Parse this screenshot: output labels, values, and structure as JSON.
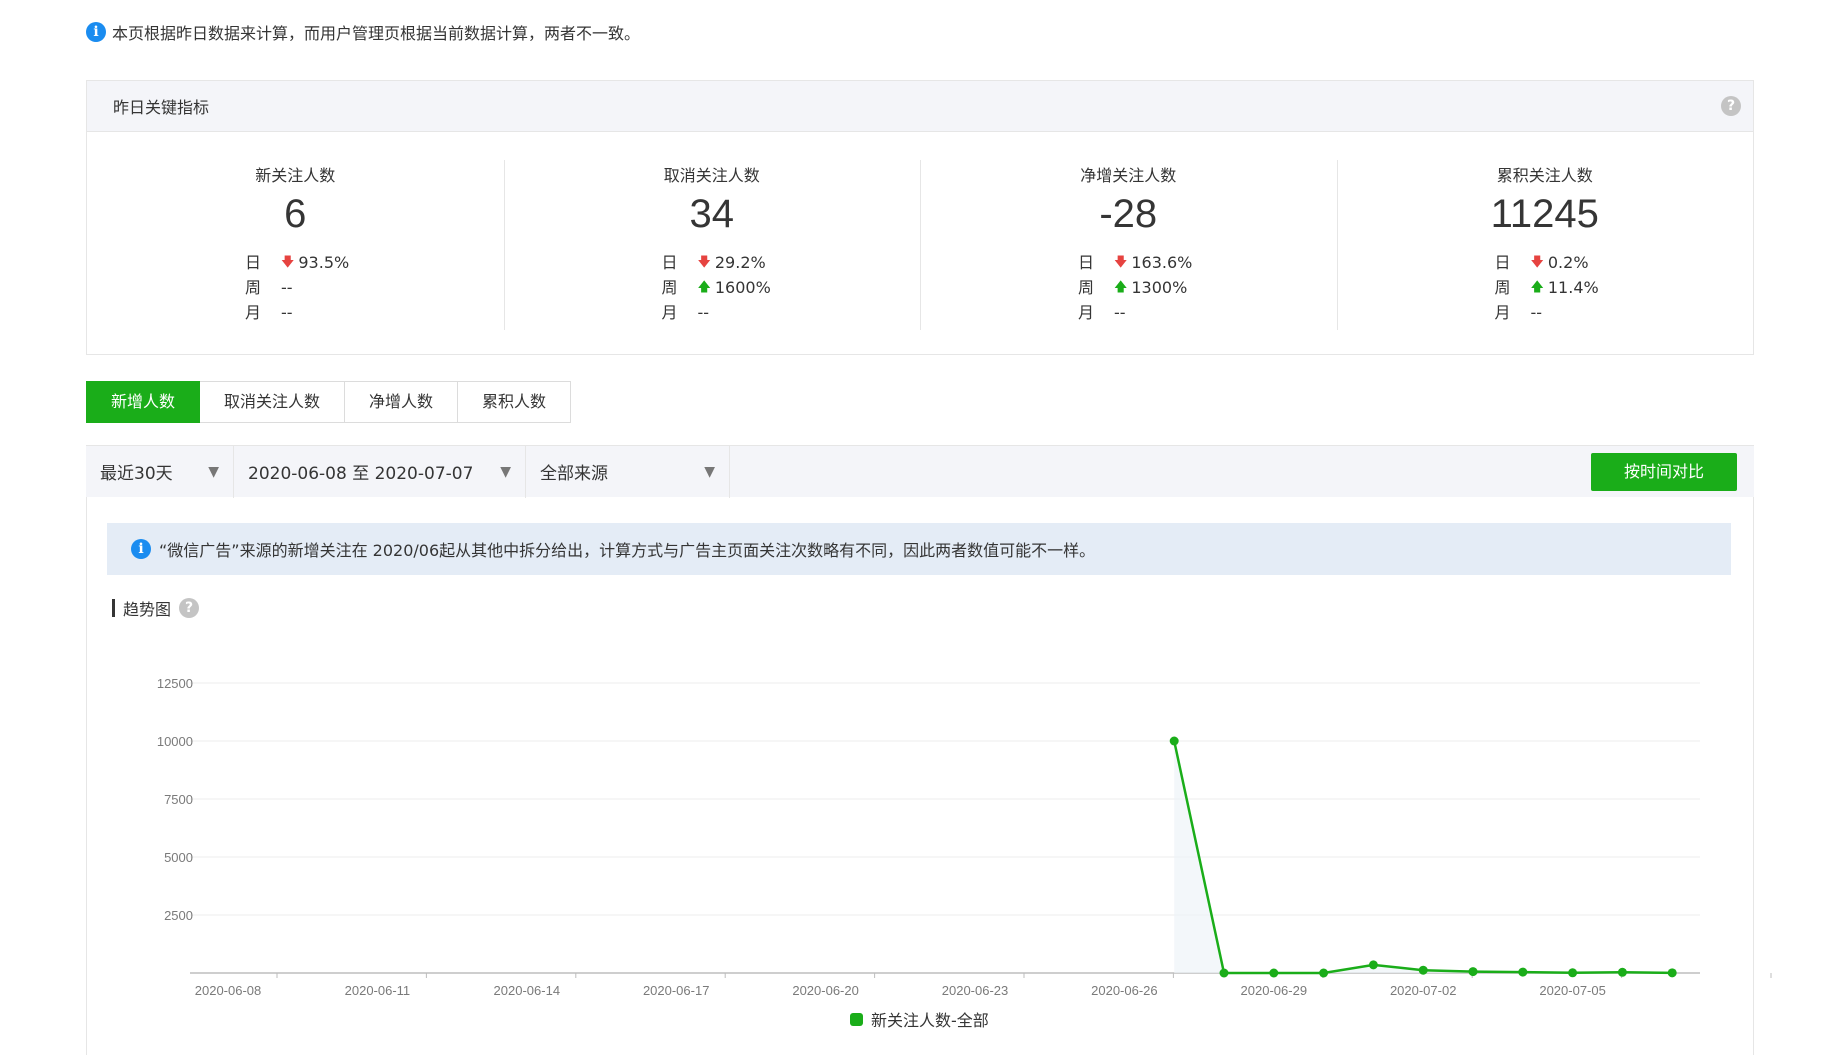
{
  "top_notice": {
    "icon": "info-icon",
    "text": "本页根据昨日数据来计算，而用户管理页根据当前数据计算，两者不一致。"
  },
  "key_metrics": {
    "title": "昨日关键指标",
    "help_icon": "question-icon",
    "period_labels": [
      "日",
      "周",
      "月"
    ],
    "items": [
      {
        "label": "新关注人数",
        "value": "6",
        "changes": [
          {
            "dir": "down",
            "text": "93.5%"
          },
          {
            "dir": "none",
            "text": "--"
          },
          {
            "dir": "none",
            "text": "--"
          }
        ]
      },
      {
        "label": "取消关注人数",
        "value": "34",
        "changes": [
          {
            "dir": "down",
            "text": "29.2%"
          },
          {
            "dir": "up",
            "text": "1600%"
          },
          {
            "dir": "none",
            "text": "--"
          }
        ]
      },
      {
        "label": "净增关注人数",
        "value": "-28",
        "changes": [
          {
            "dir": "down",
            "text": "163.6%"
          },
          {
            "dir": "up",
            "text": "1300%"
          },
          {
            "dir": "none",
            "text": "--"
          }
        ]
      },
      {
        "label": "累积关注人数",
        "value": "11245",
        "changes": [
          {
            "dir": "down",
            "text": "0.2%"
          },
          {
            "dir": "up",
            "text": "11.4%"
          },
          {
            "dir": "none",
            "text": "--"
          }
        ]
      }
    ]
  },
  "tabs": [
    {
      "label": "新增人数",
      "active": true
    },
    {
      "label": "取消关注人数",
      "active": false
    },
    {
      "label": "净增人数",
      "active": false
    },
    {
      "label": "累积人数",
      "active": false
    }
  ],
  "filters": {
    "period": "最近30天",
    "date_range": "2020-06-08 至 2020-07-07",
    "source": "全部来源",
    "compare_button": "按时间对比"
  },
  "ad_notice": "“微信广告”来源的新增关注在 2020/06起从其他中拆分给出，计算方式与广告主页面关注次数略有不同，因此两者数值可能不一样。",
  "trend_title": "趋势图",
  "colors": {
    "accent": "#1aad19",
    "down": "#e64340",
    "info": "#1a8cf0"
  },
  "chart_data": {
    "type": "line",
    "title": "",
    "xlabel": "",
    "ylabel": "",
    "ylim": [
      0,
      12500
    ],
    "y_ticks": [
      2500,
      5000,
      7500,
      10000,
      12500
    ],
    "x_tick_labels": [
      "2020-06-08",
      "2020-06-11",
      "2020-06-14",
      "2020-06-17",
      "2020-06-20",
      "2020-06-23",
      "2020-06-26",
      "2020-06-29",
      "2020-07-02",
      "2020-07-05"
    ],
    "grid": true,
    "legend": "bottom-center",
    "series": [
      {
        "name": "新关注人数-全部",
        "x": [
          "2020-06-27",
          "2020-06-28",
          "2020-06-29",
          "2020-06-30",
          "2020-07-01",
          "2020-07-02",
          "2020-07-03",
          "2020-07-04",
          "2020-07-05",
          "2020-07-06",
          "2020-07-07"
        ],
        "values": [
          10000,
          0,
          0,
          0,
          350,
          120,
          60,
          40,
          10,
          30,
          6
        ]
      }
    ]
  }
}
